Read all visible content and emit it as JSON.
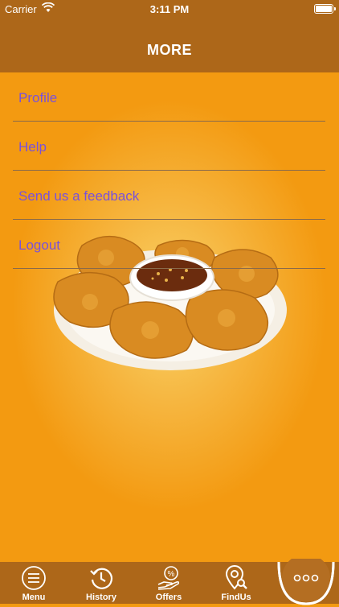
{
  "status_bar": {
    "carrier": "Carrier",
    "time": "3:11 PM"
  },
  "header": {
    "title": "MORE"
  },
  "menu": {
    "items": [
      {
        "label": "Profile"
      },
      {
        "label": "Help"
      },
      {
        "label": "Send us a feedback"
      },
      {
        "label": "Logout"
      }
    ]
  },
  "tabbar": {
    "tabs": [
      {
        "label": "Menu",
        "icon": "menu-icon"
      },
      {
        "label": "History",
        "icon": "history-icon"
      },
      {
        "label": "Offers",
        "icon": "offers-icon"
      },
      {
        "label": "FindUs",
        "icon": "location-search-icon"
      }
    ],
    "more_icon": "more-dots-icon"
  },
  "colors": {
    "bar": "#ad6719",
    "background": "#f39a11",
    "menu_text": "#7a52d9",
    "divider": "#8a6a4a"
  }
}
